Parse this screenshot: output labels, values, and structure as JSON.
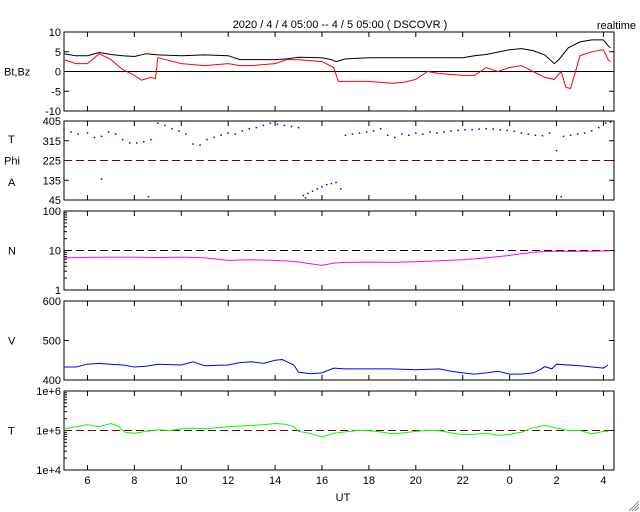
{
  "title": "2020 / 4 / 4   05:00 --  4 / 5   05:00 ( DSCOVR )",
  "mode_label": "realtime",
  "chart_data": [
    {
      "type": "line",
      "name": "magnetic-field",
      "ylabels": [
        "Bt,Bz"
      ],
      "scale": "linear",
      "ylim": [
        -10,
        10
      ],
      "yticks": [
        {
          "v": 10,
          "label": "10"
        },
        {
          "v": 5,
          "label": "5"
        },
        {
          "v": 0,
          "label": "0"
        },
        {
          "v": -5,
          "label": "-5"
        },
        {
          "v": -10,
          "label": "-10"
        }
      ],
      "refline": {
        "v": 0,
        "style": "solid",
        "color": "#000000"
      },
      "series": [
        {
          "name": "Bt",
          "color": "#000000",
          "mode": "line",
          "x": [
            5,
            5.5,
            6,
            6.5,
            7,
            7.5,
            8,
            8.5,
            9,
            10,
            11,
            12,
            12.5,
            13,
            14,
            14.5,
            15,
            16,
            16.4,
            16.6,
            17,
            18,
            20,
            22,
            22.5,
            23,
            24,
            24.5,
            25,
            25.5,
            25.9,
            26.1,
            26.5,
            27,
            27.5,
            28,
            28.2,
            28.3
          ],
          "y": [
            4.5,
            4,
            4,
            4.8,
            4.3,
            4,
            3.8,
            4.5,
            4.2,
            4,
            4.2,
            4,
            3,
            3,
            3,
            3.2,
            3.6,
            3.5,
            3,
            2.5,
            3.2,
            3.5,
            3.5,
            3.5,
            4,
            4.3,
            5.5,
            5.8,
            5.3,
            4.2,
            2,
            3,
            6,
            7.5,
            8,
            8,
            6.5,
            6
          ]
        },
        {
          "name": "Bz",
          "color": "#ff0000",
          "mode": "line",
          "x": [
            5,
            5.5,
            6,
            6.5,
            7,
            7.5,
            8,
            8.3,
            8.7,
            8.9,
            9,
            10,
            11,
            12,
            12.5,
            13,
            14,
            14.5,
            15,
            16,
            16.5,
            16.7,
            17,
            18,
            19,
            19.5,
            20,
            20.5,
            21,
            22,
            22.5,
            23,
            23.5,
            24,
            24.5,
            25,
            25.5,
            25.9,
            26.2,
            26.4,
            26.6,
            27,
            27.5,
            28,
            28.2,
            28.3
          ],
          "y": [
            3,
            2,
            2,
            4.5,
            3,
            0.5,
            -1,
            -2.2,
            -1.5,
            -1.8,
            3.5,
            2,
            1.5,
            2,
            1.5,
            1.5,
            2,
            3,
            3,
            2.5,
            1,
            -2.5,
            -2.5,
            -2.5,
            -3,
            -2.7,
            -2,
            0,
            -0.5,
            -1,
            -1,
            1,
            0,
            1,
            1.5,
            0,
            -1.5,
            -2,
            0,
            -4,
            -4.3,
            4,
            5,
            5.5,
            3,
            2.5
          ]
        }
      ]
    },
    {
      "type": "scatter",
      "name": "phi-angle",
      "ylabels": [
        "T",
        "Phi",
        "A"
      ],
      "scale": "linear",
      "ylim": [
        45,
        405
      ],
      "yticks": [
        {
          "v": 405,
          "label": "405"
        },
        {
          "v": 315,
          "label": "315"
        },
        {
          "v": 225,
          "label": "225"
        },
        {
          "v": 135,
          "label": "135"
        },
        {
          "v": 45,
          "label": "45"
        }
      ],
      "refline": {
        "v": 225,
        "style": "dashed",
        "color": "#800000"
      },
      "series": [
        {
          "name": "Phi",
          "color": "#0000ff",
          "mode": "dots",
          "x": [
            5,
            5.3,
            5.6,
            6,
            6.3,
            6.6,
            6.9,
            7.2,
            7.5,
            7.8,
            8.1,
            8.4,
            8.7,
            9,
            9.3,
            9.6,
            9.9,
            10.2,
            10.5,
            10.8,
            11.1,
            11.4,
            11.7,
            12,
            12.3,
            12.6,
            12.9,
            13.2,
            13.5,
            13.8,
            14.1,
            14.4,
            14.7,
            15,
            15.2,
            15.4,
            15.6,
            15.8,
            16,
            16.2,
            16.4,
            16.6,
            16.8,
            17,
            17.3,
            17.6,
            17.9,
            18.2,
            18.5,
            18.8,
            19.1,
            19.4,
            19.7,
            20,
            20.3,
            20.6,
            20.9,
            21.2,
            21.5,
            21.8,
            22.1,
            22.4,
            22.7,
            23,
            23.3,
            23.6,
            23.9,
            24.2,
            24.5,
            24.8,
            25.1,
            25.4,
            25.7,
            26,
            26.3,
            26.6,
            26.9,
            27.2,
            27.5,
            27.8,
            28.1,
            28.3,
            6.6,
            8.6,
            15.3,
            26.2
          ],
          "y": [
            365,
            355,
            345,
            350,
            330,
            335,
            355,
            345,
            320,
            305,
            305,
            310,
            320,
            395,
            385,
            370,
            360,
            345,
            300,
            295,
            320,
            330,
            340,
            350,
            345,
            360,
            370,
            375,
            385,
            395,
            390,
            385,
            380,
            375,
            65,
            75,
            85,
            95,
            105,
            115,
            120,
            125,
            95,
            340,
            345,
            350,
            355,
            360,
            370,
            340,
            330,
            345,
            340,
            350,
            345,
            355,
            350,
            355,
            360,
            362,
            365,
            365,
            368,
            370,
            368,
            365,
            362,
            358,
            350,
            345,
            340,
            338,
            350,
            270,
            335,
            340,
            345,
            350,
            360,
            375,
            395,
            400,
            140,
            60,
            55,
            60
          ]
        }
      ]
    },
    {
      "type": "line",
      "name": "density",
      "ylabels": [
        "N"
      ],
      "scale": "log",
      "ylim": [
        1,
        100
      ],
      "yticks": [
        {
          "v": 100,
          "label": "100"
        },
        {
          "v": 10,
          "label": "10"
        },
        {
          "v": 1,
          "label": "1"
        }
      ],
      "refline": {
        "v": 10,
        "style": "dashed",
        "color": "#000000"
      },
      "series": [
        {
          "name": "N",
          "color": "#ff00ff",
          "mode": "line",
          "x": [
            5,
            6,
            7,
            8,
            9,
            10,
            11,
            12,
            13,
            14,
            14.8,
            15.5,
            16,
            16.5,
            17,
            18,
            19,
            20,
            21,
            22,
            23,
            24,
            24.5,
            25,
            25.5,
            26,
            27,
            28,
            28.3
          ],
          "y": [
            6.5,
            6.7,
            6.8,
            6.8,
            6.6,
            6.8,
            6.5,
            5.6,
            5.8,
            5.6,
            5.3,
            4.6,
            4.2,
            4.8,
            5,
            5.1,
            5,
            5.2,
            5.5,
            5.8,
            6.5,
            7.5,
            8.3,
            9,
            9.4,
            9.6,
            9.5,
            9.7,
            9.8
          ]
        }
      ]
    },
    {
      "type": "line",
      "name": "velocity",
      "ylabels": [
        "V"
      ],
      "scale": "linear",
      "ylim": [
        400,
        600
      ],
      "yticks": [
        {
          "v": 600,
          "label": "600"
        },
        {
          "v": 500,
          "label": "500"
        },
        {
          "v": 400,
          "label": "400"
        }
      ],
      "refline": null,
      "series": [
        {
          "name": "V",
          "color": "#0000ff",
          "mode": "line",
          "x": [
            5,
            5.5,
            6,
            6.5,
            7,
            7.5,
            8,
            8.5,
            9,
            10,
            10.5,
            11,
            12,
            12.5,
            13,
            13.5,
            14,
            14.3,
            14.8,
            15,
            15.5,
            16,
            16.5,
            17,
            18,
            19,
            20,
            21,
            21.5,
            22,
            22.5,
            23,
            23.5,
            24,
            24.5,
            25,
            25.3,
            25.5,
            25.8,
            26,
            27,
            28,
            28.2
          ],
          "y": [
            433,
            433,
            440,
            442,
            440,
            438,
            433,
            435,
            440,
            438,
            446,
            436,
            438,
            444,
            446,
            442,
            450,
            452,
            438,
            420,
            416,
            418,
            430,
            428,
            428,
            428,
            426,
            428,
            422,
            418,
            415,
            418,
            422,
            415,
            415,
            418,
            426,
            434,
            428,
            440,
            436,
            430,
            438
          ]
        }
      ]
    },
    {
      "type": "line",
      "name": "temperature",
      "ylabels": [
        "T"
      ],
      "scale": "log",
      "ylim": [
        10000,
        1000000
      ],
      "yticks": [
        {
          "v": 1000000,
          "label": "1e+6"
        },
        {
          "v": 100000,
          "label": "1e+5"
        },
        {
          "v": 10000,
          "label": "1e+4"
        }
      ],
      "refline": {
        "v": 100000,
        "style": "dashed",
        "color": "#800000"
      },
      "series": [
        {
          "name": "T",
          "color": "#00ff00",
          "mode": "line",
          "x": [
            5,
            5.5,
            6,
            6.5,
            7,
            7.3,
            7.6,
            8,
            8.5,
            9,
            9.5,
            10,
            10.5,
            11,
            11.5,
            12,
            12.5,
            13,
            13.5,
            14,
            14.4,
            14.8,
            15,
            15.5,
            16,
            16.5,
            17,
            17.5,
            18,
            18.5,
            19,
            19.5,
            20,
            20.5,
            21,
            21.5,
            22,
            22.5,
            23,
            23.5,
            24,
            24.5,
            25,
            25.5,
            26,
            26.5,
            27,
            27.5,
            28,
            28.2
          ],
          "y": [
            110000,
            125000,
            140000,
            125000,
            150000,
            130000,
            90000,
            85000,
            95000,
            105000,
            100000,
            110000,
            115000,
            110000,
            118000,
            125000,
            130000,
            135000,
            140000,
            150000,
            145000,
            125000,
            95000,
            85000,
            68000,
            85000,
            92000,
            100000,
            98000,
            92000,
            82000,
            88000,
            95000,
            100000,
            98000,
            88000,
            78000,
            80000,
            85000,
            75000,
            80000,
            90000,
            118000,
            135000,
            115000,
            100000,
            100000,
            82000,
            95000,
            95000
          ]
        }
      ]
    }
  ],
  "xaxis": {
    "label": "UT",
    "xlim": [
      5,
      28.45
    ],
    "ticks": [
      {
        "v": 6,
        "label": "6"
      },
      {
        "v": 8,
        "label": "8"
      },
      {
        "v": 10,
        "label": "10"
      },
      {
        "v": 12,
        "label": "12"
      },
      {
        "v": 14,
        "label": "14"
      },
      {
        "v": 16,
        "label": "16"
      },
      {
        "v": 18,
        "label": "18"
      },
      {
        "v": 20,
        "label": "20"
      },
      {
        "v": 22,
        "label": "22"
      },
      {
        "v": 24,
        "label": "0"
      },
      {
        "v": 26,
        "label": "2"
      },
      {
        "v": 28,
        "label": "4"
      }
    ]
  }
}
